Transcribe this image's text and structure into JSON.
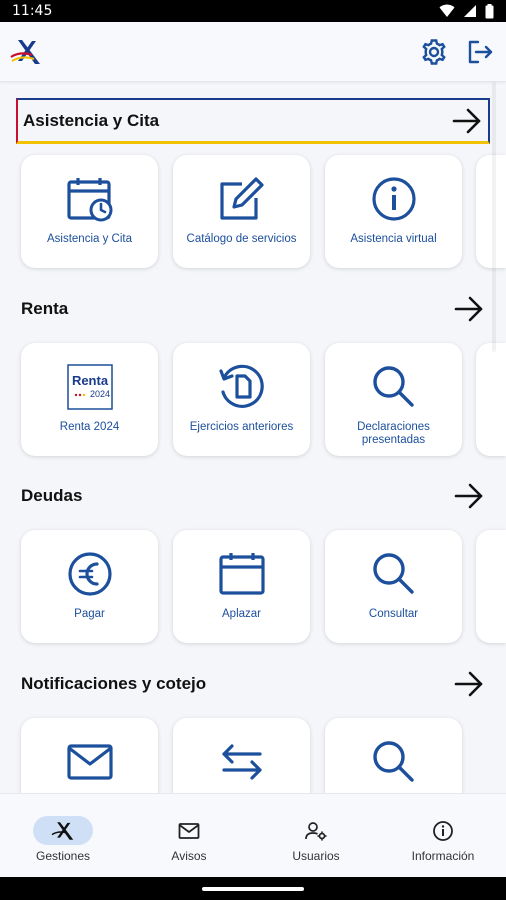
{
  "status_bar": {
    "time": "11:45"
  },
  "app_bar": {
    "logo_icon": "aeat-logo-icon",
    "settings_icon": "gear-icon",
    "logout_icon": "logout-icon"
  },
  "sections": [
    {
      "title": "Asistencia y Cita",
      "cards": [
        {
          "label": "Asistencia y Cita",
          "icon": "calendar-clock-icon"
        },
        {
          "label": "Catálogo de servicios",
          "icon": "edit-icon"
        },
        {
          "label": "Asistencia virtual",
          "icon": "info-icon"
        }
      ]
    },
    {
      "title": "Renta",
      "cards": [
        {
          "label": "Renta 2024",
          "icon": "renta-2024-logo",
          "logo_title": "Renta",
          "logo_year": "2024"
        },
        {
          "label": "Ejercicios anteriores",
          "icon": "history-document-icon"
        },
        {
          "label": "Declaraciones presentadas",
          "icon": "search-icon"
        }
      ]
    },
    {
      "title": "Deudas",
      "cards": [
        {
          "label": "Pagar",
          "icon": "euro-icon"
        },
        {
          "label": "Aplazar",
          "icon": "calendar-icon"
        },
        {
          "label": "Consultar",
          "icon": "search-icon"
        }
      ]
    },
    {
      "title": "Notificaciones y cotejo",
      "cards": [
        {
          "label": "",
          "icon": "mail-icon"
        },
        {
          "label": "",
          "icon": "swap-arrows-icon"
        },
        {
          "label": "",
          "icon": "search-icon"
        }
      ]
    }
  ],
  "bottom_nav": [
    {
      "label": "Gestiones",
      "icon": "aeat-logo-icon",
      "active": true
    },
    {
      "label": "Avisos",
      "icon": "mail-icon",
      "active": false
    },
    {
      "label": "Usuarios",
      "icon": "user-settings-icon",
      "active": false
    },
    {
      "label": "Información",
      "icon": "info-icon",
      "active": false
    }
  ],
  "colors": {
    "primary": "#1c4f9c",
    "active_nav": "#cfe0f6",
    "background": "#f4f6fa"
  }
}
